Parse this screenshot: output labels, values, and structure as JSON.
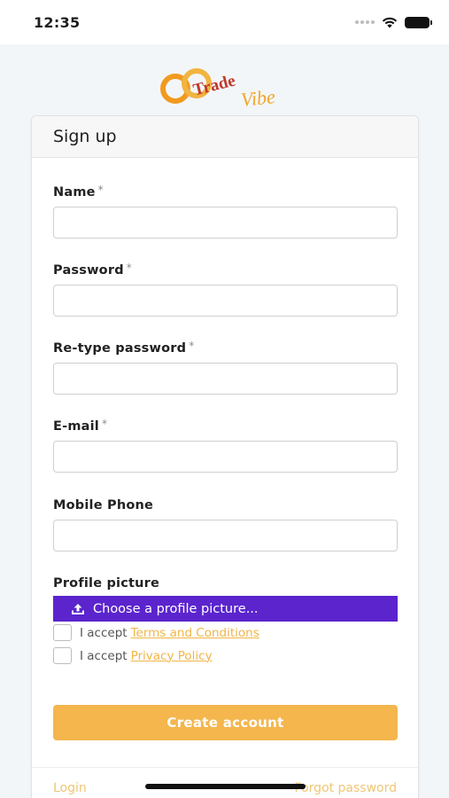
{
  "status_bar": {
    "time": "12:35"
  },
  "logo": {
    "text_trade": "Trade",
    "text_vibe": "Vibe"
  },
  "form": {
    "title": "Sign up",
    "required_mark": "*",
    "fields": {
      "name": {
        "label": "Name",
        "value": ""
      },
      "password": {
        "label": "Password",
        "value": ""
      },
      "retype_password": {
        "label": "Re-type password",
        "value": ""
      },
      "email": {
        "label": "E-mail",
        "value": ""
      },
      "mobile_phone": {
        "label": "Mobile Phone",
        "value": ""
      }
    },
    "profile_picture": {
      "label": "Profile picture",
      "button_label": "Choose a profile picture..."
    },
    "terms": {
      "prefix": "I accept",
      "link": "Terms and Conditions"
    },
    "privacy": {
      "prefix": "I accept",
      "link": "Privacy Policy"
    },
    "submit_label": "Create account"
  },
  "footer": {
    "login": "Login",
    "forgot": "Forgot password"
  },
  "colors": {
    "accent_purple": "#5b24cd",
    "accent_orange": "#f4b64d",
    "link_orange": "#f0b547",
    "logo_red": "#c0392b"
  },
  "icons": [
    "wifi-icon",
    "battery-icon",
    "upload-icon",
    "logo-mark-icon"
  ]
}
